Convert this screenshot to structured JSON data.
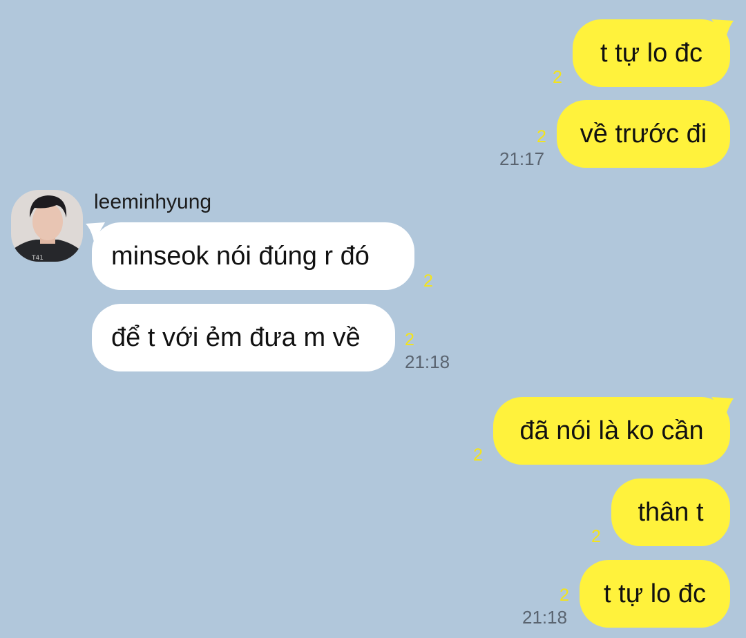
{
  "chat": {
    "bg_color": "#b1c7db",
    "out_bubble_color": "#fff23c",
    "in_bubble_color": "#ffffff",
    "unread_color": "#f4e41a",
    "sender": {
      "name": "leeminhyung",
      "avatar_icon": "profile-photo"
    },
    "messages": [
      {
        "dir": "out",
        "text": "t tự lo đc",
        "unread": "2",
        "time": ""
      },
      {
        "dir": "out",
        "text": "về trước đi",
        "unread": "2",
        "time": "21:17"
      },
      {
        "dir": "in",
        "text": "minseok nói đúng r đó",
        "unread": "2",
        "time": ""
      },
      {
        "dir": "in",
        "text": "để t với ẻm đưa m về",
        "unread": "2",
        "time": "21:18"
      },
      {
        "dir": "out",
        "text": "đã nói là ko cần",
        "unread": "2",
        "time": ""
      },
      {
        "dir": "out",
        "text": "thân t",
        "unread": "2",
        "time": ""
      },
      {
        "dir": "out",
        "text": "t tự lo đc",
        "unread": "2",
        "time": "21:18"
      }
    ]
  }
}
